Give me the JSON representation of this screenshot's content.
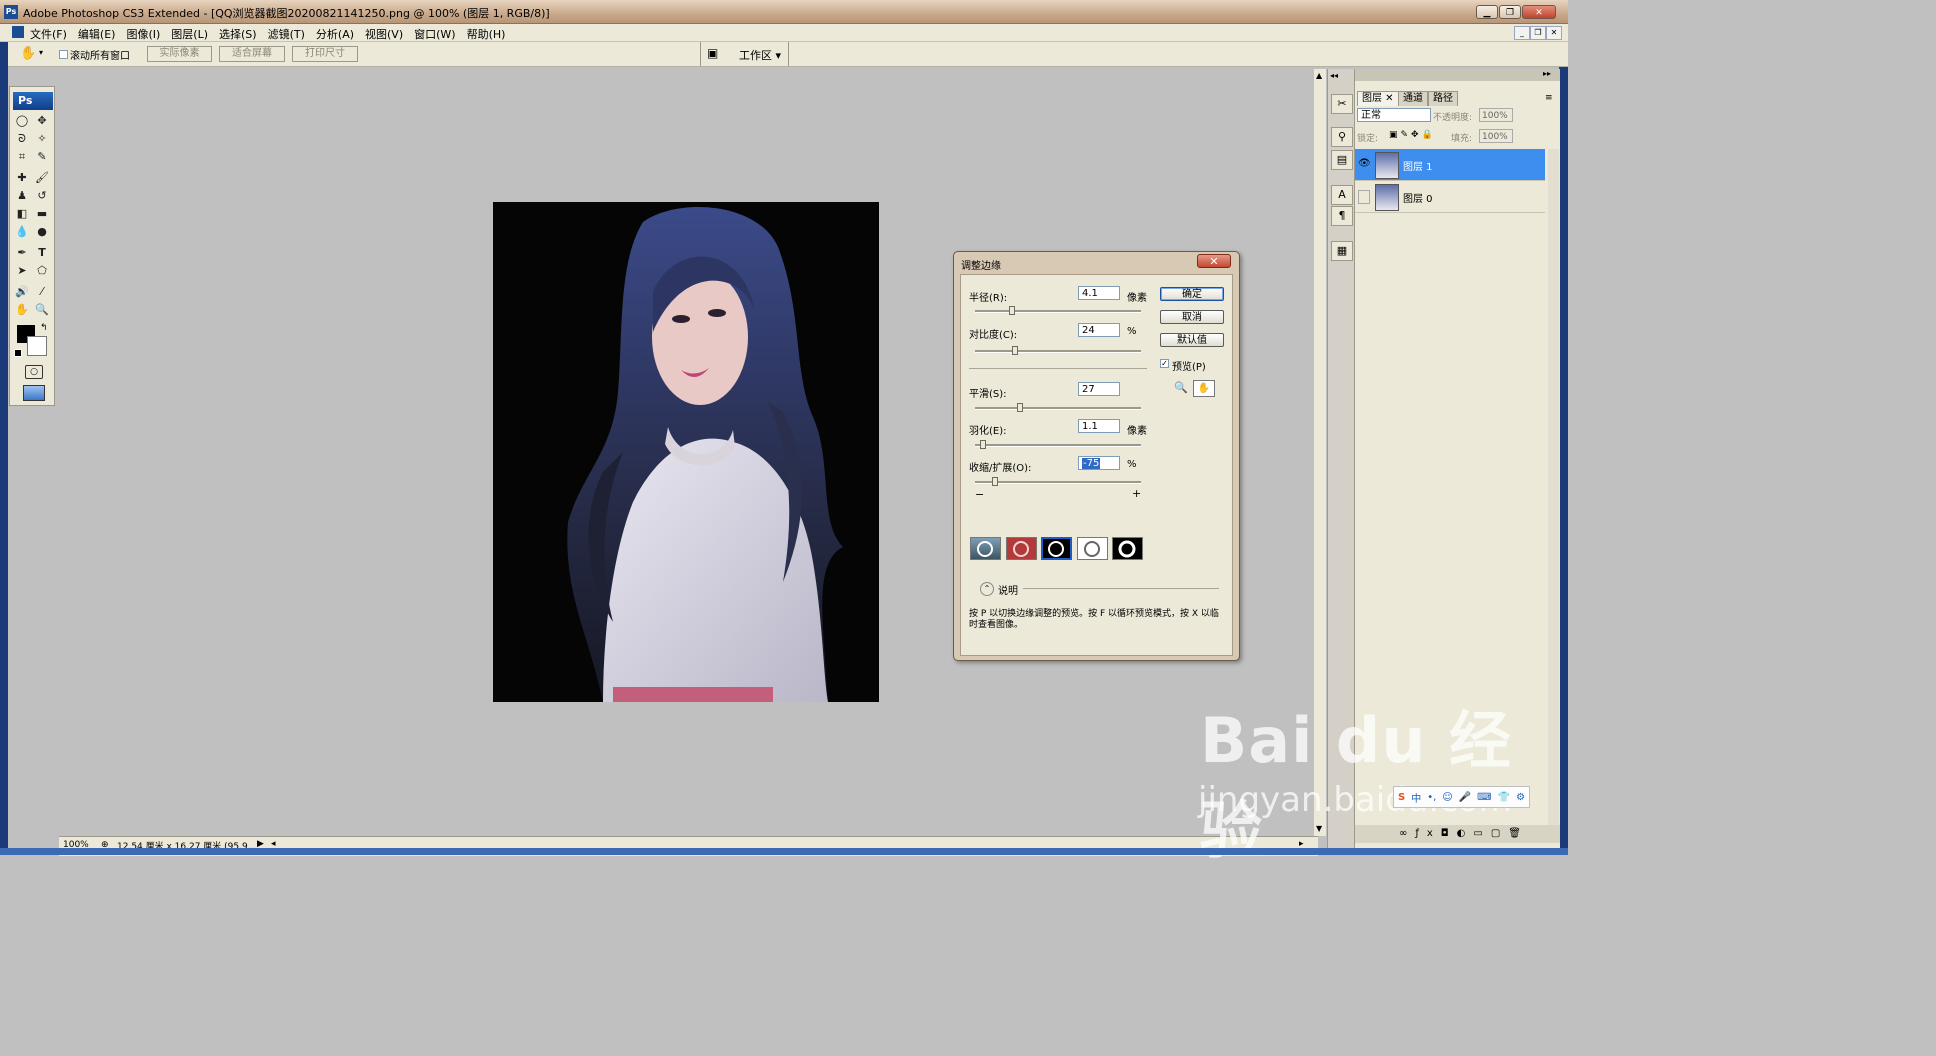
{
  "window": {
    "title": "Adobe Photoshop CS3 Extended - [QQ浏览器截图20200821141250.png @ 100% (图层 1, RGB/8)]",
    "app_icon": "Ps"
  },
  "menu": [
    "文件(F)",
    "编辑(E)",
    "图像(I)",
    "图层(L)",
    "选择(S)",
    "滤镜(T)",
    "分析(A)",
    "视图(V)",
    "窗口(W)",
    "帮助(H)"
  ],
  "options": {
    "scroll_all_label": "滚动所有窗口",
    "actual_pixels": "实际像素",
    "fit_screen": "适合屏幕",
    "print_size": "打印尺寸",
    "workspace": "工作区 ▾"
  },
  "toolbox": {
    "logo": "Ps"
  },
  "status": {
    "zoom": "100%",
    "doc_info": "12.54 厘米 x 16.27 厘米 (95.9..."
  },
  "layers_panel": {
    "tabs": [
      "图层",
      "通道",
      "路径"
    ],
    "blend_mode": "正常",
    "opacity_label": "不透明度:",
    "opacity_value": "100%",
    "lock_label": "锁定:",
    "fill_label": "填充:",
    "fill_value": "100%",
    "layers": [
      {
        "name": "图层 1",
        "selected": true,
        "visible": true
      },
      {
        "name": "图层 0",
        "selected": false,
        "visible": false
      }
    ]
  },
  "dialog": {
    "title": "调整边缘",
    "radius_label": "半径(R):",
    "radius_value": "4.1",
    "radius_unit": "像素",
    "radius_pos": 0.22,
    "contrast_label": "对比度(C):",
    "contrast_value": "24",
    "contrast_unit": "%",
    "contrast_pos": 0.24,
    "smooth_label": "平滑(S):",
    "smooth_value": "27",
    "smooth_pos": 0.27,
    "feather_label": "羽化(E):",
    "feather_value": "1.1",
    "feather_unit": "像素",
    "feather_pos": 0.05,
    "contract_label": "收缩/扩展(O):",
    "contract_value": "-75",
    "contract_unit": "%",
    "contract_pos": 0.12,
    "minus": "−",
    "plus": "+",
    "ok": "确定",
    "cancel": "取消",
    "default": "默认值",
    "preview_label": "预览(P)",
    "desc_label": "说明",
    "desc_text": "按 P 以切换边缘调整的预览。按 F 以循环预览模式，按 X 以临时查看图像。"
  },
  "watermark": {
    "brand": "Bai du 经验",
    "url": "jingyan.baidu.com"
  },
  "ime": {
    "items": [
      "S",
      "中",
      "•,",
      "☺",
      "🎤",
      "⌨",
      "👕",
      "⚙"
    ]
  }
}
